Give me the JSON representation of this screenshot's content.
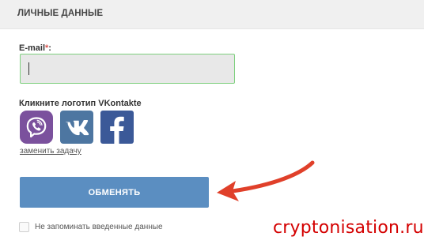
{
  "section": {
    "title": "ЛИЧНЫЕ ДАННЫЕ"
  },
  "email": {
    "label": "E-mail",
    "required_mark": "*",
    "label_suffix": ":",
    "value": ""
  },
  "social": {
    "label": "Кликните логотип VKontakte",
    "icons": [
      "viber-icon",
      "vk-icon",
      "facebook-icon"
    ],
    "change_link": "заменить задачу"
  },
  "submit": {
    "label": "ОБМЕНЯТЬ"
  },
  "remember": {
    "checked": false,
    "label": "Не запоминать введенные данные"
  },
  "watermark": "cryptonisation.ru",
  "colors": {
    "section_bg": "#f0f0f0",
    "input_border": "#7ed07e",
    "input_bg": "#e8e8e8",
    "button_bg": "#5b8ec1",
    "arrow": "#e0402a",
    "viber": "#7b519d",
    "vk": "#4d76a1",
    "facebook": "#3b5998",
    "watermark": "#d40000"
  }
}
